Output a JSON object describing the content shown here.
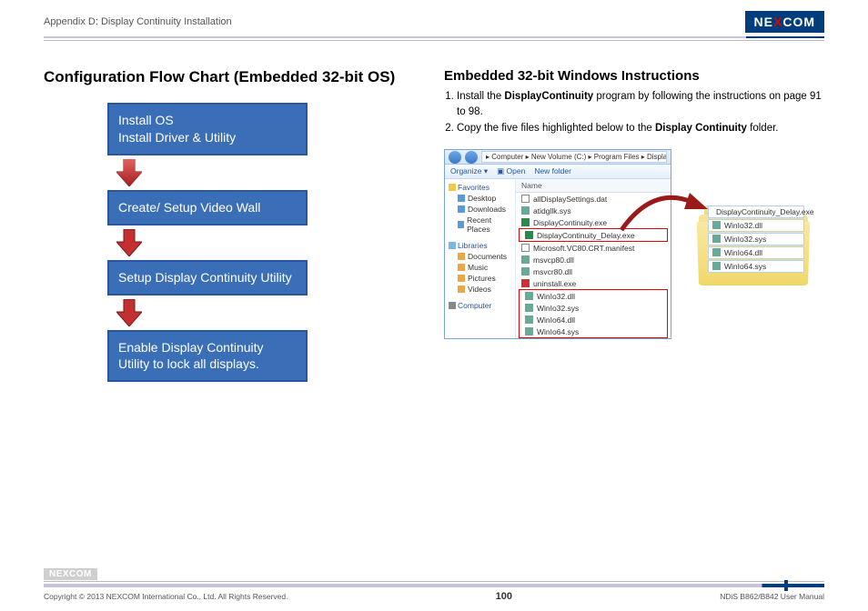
{
  "header": {
    "section": "Appendix D: Display Continuity Installation",
    "logo": "NEXCOM"
  },
  "main_title": "Configuration Flow Chart (Embedded 32-bit OS)",
  "flow": {
    "step1": "Install OS\nInstall Driver & Utility",
    "step2": "Create/ Setup Video Wall",
    "step3": "Setup Display Continuity Utility",
    "step4": "Enable Display Continuity Utility to lock all displays."
  },
  "right": {
    "heading": "Embedded 32-bit Windows Instructions",
    "li1_pre": "Install the ",
    "li1_bold": "DisplayContinuity",
    "li1_post": " program by following the instructions on page 91 to 98.",
    "li2_pre": "Copy the five files highlighted below to the ",
    "li2_bold": "Display Continuity",
    "li2_post": " folder."
  },
  "explorer": {
    "breadcrumb": "▸ Computer ▸ New Volume (C:) ▸ Program Files ▸ Displa",
    "toolbar": {
      "organize": "Organize ▾",
      "open": "▣ Open",
      "newfolder": "New folder"
    },
    "sidebar": {
      "favorites": "Favorites",
      "desktop": "Desktop",
      "downloads": "Downloads",
      "recent": "Recent Places",
      "libraries": "Libraries",
      "documents": "Documents",
      "music": "Music",
      "pictures": "Pictures",
      "videos": "Videos",
      "computer": "Computer"
    },
    "name_col": "Name",
    "files": {
      "f1": "allDisplaySettings.dat",
      "f2": "atidgllk.sys",
      "f3": "DisplayContinuity.exe",
      "f4": "DisplayContinuity_Delay.exe",
      "f5": "Microsoft.VC80.CRT.manifest",
      "f6": "msvcp80.dll",
      "f7": "msvcr80.dll",
      "f8": "uninstall.exe",
      "f9": "WinIo32.dll",
      "f10": "WinIo32.sys",
      "f11": "WinIo64.dll",
      "f12": "WinIo64.sys"
    }
  },
  "folder_files": {
    "t1": "DisplayContinuity_Delay.exe",
    "t2": "WinIo32.dll",
    "t3": "WinIo32.sys",
    "t4": "WinIo64.dll",
    "t5": "WinIo64.sys"
  },
  "footer": {
    "copyright": "Copyright © 2013 NEXCOM International Co., Ltd. All Rights Reserved.",
    "page": "100",
    "manual": "NDiS B862/B842 User Manual",
    "logo": "NEXCOM"
  }
}
